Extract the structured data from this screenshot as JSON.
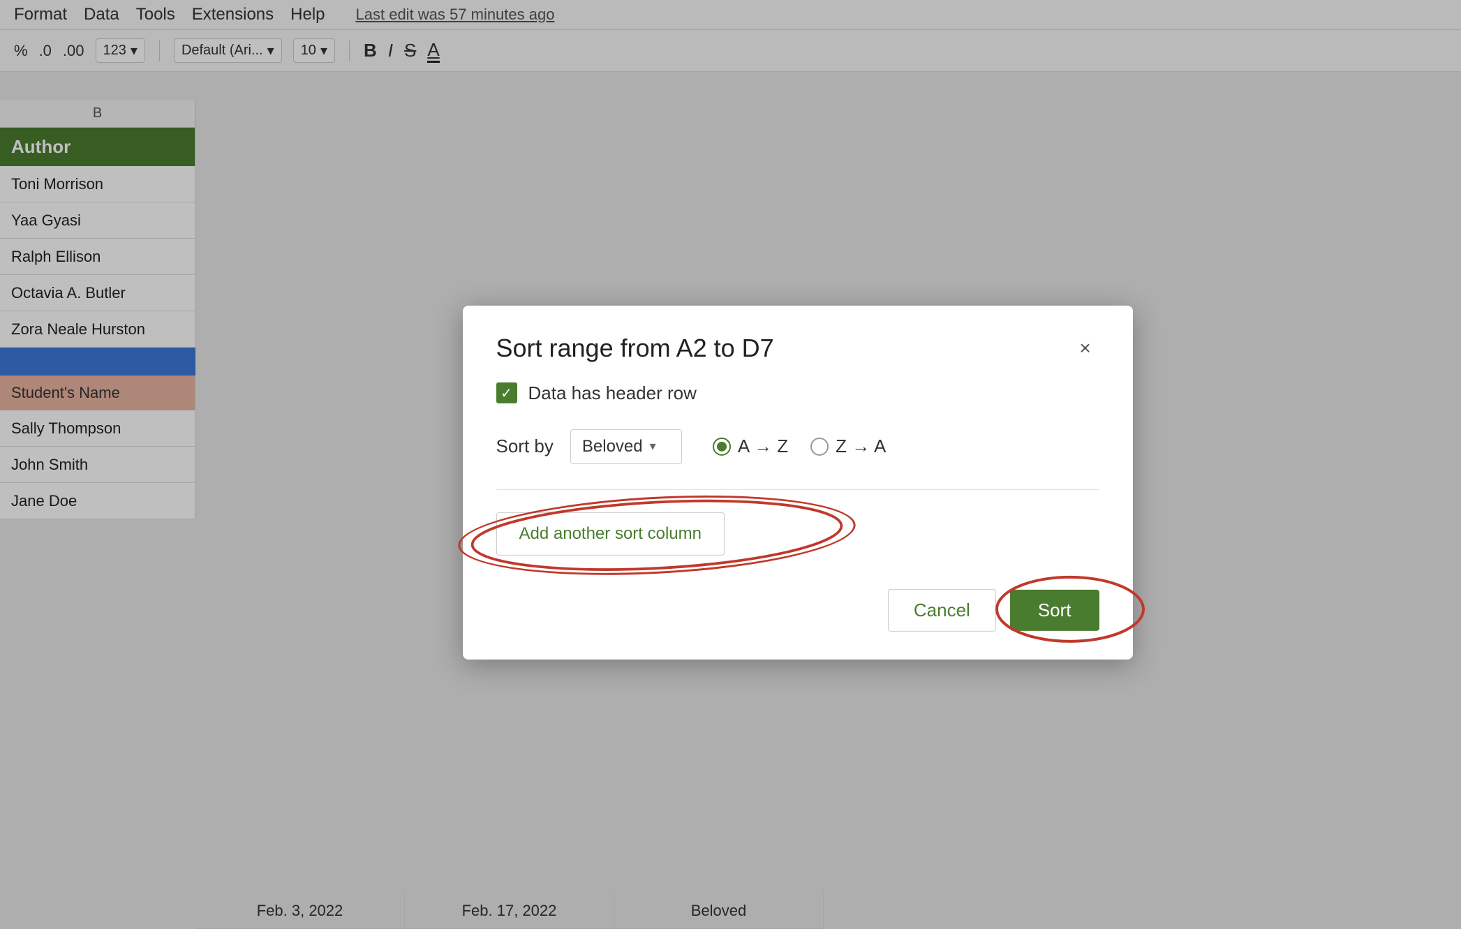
{
  "menu": {
    "items": [
      "Format",
      "Data",
      "Tools",
      "Extensions",
      "Help"
    ],
    "last_edit": "Last edit was 57 minutes ago"
  },
  "toolbar": {
    "percent": "%",
    "decimal1": ".0",
    "decimal2": ".00",
    "number_format": "123",
    "font_family": "Default (Ari...",
    "font_size": "10",
    "bold": "B",
    "italic": "I",
    "strikethrough": "S",
    "underline": "A"
  },
  "spreadsheet": {
    "col_b_header": "Author",
    "rows": [
      "Toni Morrison",
      "Yaa Gyasi",
      "Ralph Ellison",
      "Octavia A. Butler",
      "Zora Neale Hurston"
    ],
    "bottom_header": "Student's Name",
    "bottom_rows": [
      "Sally Thompson",
      "John Smith",
      "Jane Doe"
    ],
    "date1": "Feb. 3, 2022",
    "date2": "Feb. 17, 2022",
    "book": "Beloved"
  },
  "modal": {
    "title": "Sort range from A2 to D7",
    "close_label": "×",
    "checkbox_label": "Data has header row",
    "sort_by_label": "Sort by",
    "dropdown_value": "Beloved",
    "radio_az": "A → Z",
    "radio_za": "Z → A",
    "add_sort_btn": "Add another sort column",
    "cancel_btn": "Cancel",
    "sort_btn": "Sort"
  },
  "colors": {
    "green": "#4a7c2f",
    "red_annotation": "#c0392b",
    "blue_row": "#3c78d8",
    "salmon": "#e8b4a0"
  }
}
